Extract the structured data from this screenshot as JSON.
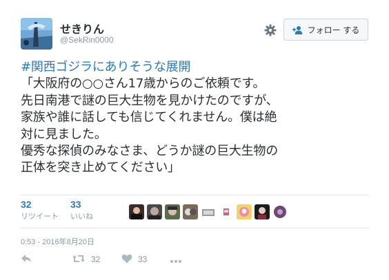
{
  "user": {
    "display_name": "せきりん",
    "handle": "@SekRin0000"
  },
  "follow_button": {
    "label": "フォロー する"
  },
  "tweet": {
    "hashtag": "#関西ゴジラにありそうな展開",
    "lines": [
      "「大阪府の○○さん17歳からのご依頼です。",
      "先日南港で謎の巨大生物を見かけたのですが、",
      "家族や誰に話しても信じてくれません。僕は絶",
      "対に見ました。",
      "優秀な探偵のみなさま、どうか謎の巨大生物の",
      "正体を突き止めてください」"
    ]
  },
  "stats": {
    "retweets": {
      "count": "32",
      "label": "リツイート"
    },
    "likes": {
      "count": "33",
      "label": "いいね"
    }
  },
  "timestamp": "0:53 - 2016年8月20日",
  "actions": {
    "retweet_count": "32",
    "like_count": "33"
  },
  "colors": {
    "link": "#2b7bb9",
    "muted": "#8899a6",
    "text": "#292f33",
    "divider": "#e1e8ed"
  },
  "icons": [
    "gear-icon",
    "follow-person-icon",
    "reply-icon",
    "retweet-icon",
    "heart-icon",
    "more-icon"
  ]
}
